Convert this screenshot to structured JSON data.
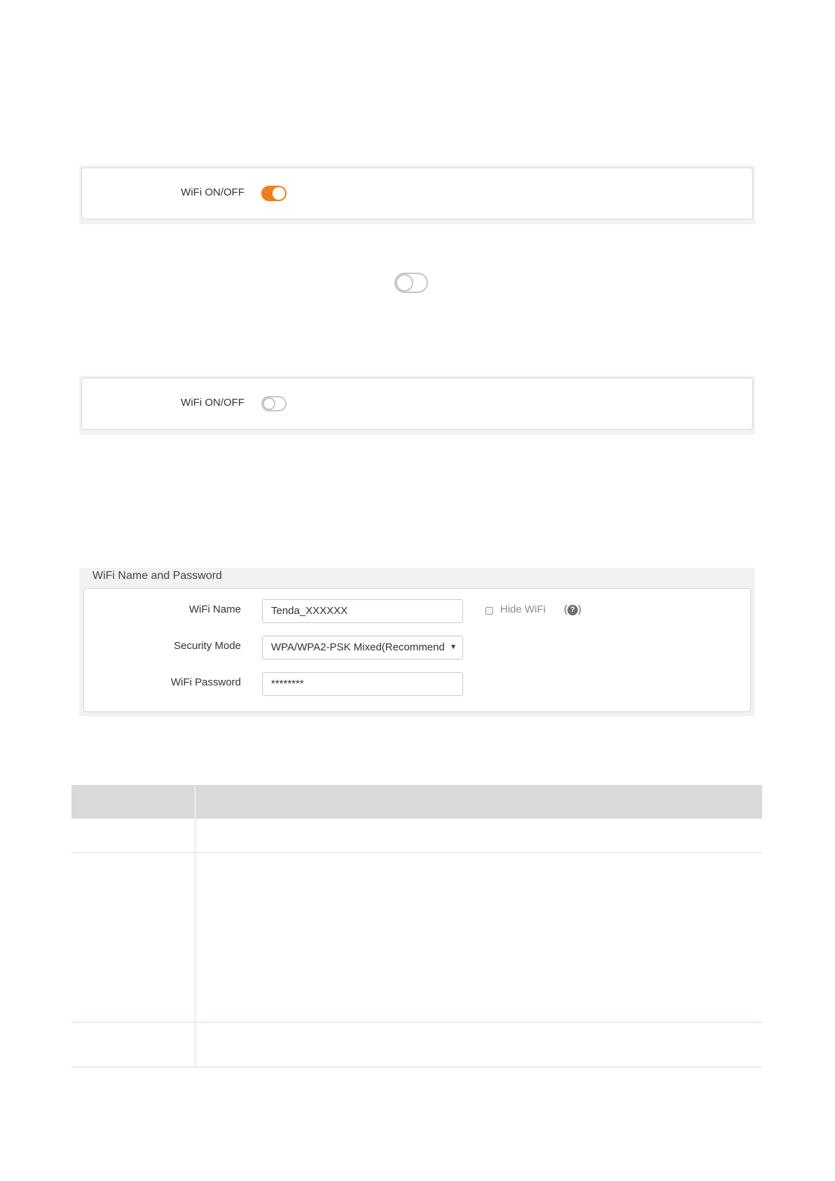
{
  "wifi_on_panel": {
    "label": "WiFi ON/OFF",
    "state": "on"
  },
  "wifi_off_panel": {
    "label": "WiFi ON/OFF",
    "state": "off"
  },
  "wifi_settings": {
    "section_title": "WiFi Name and Password",
    "wifi_name_label": "WiFi Name",
    "wifi_name_value": "Tenda_XXXXXX",
    "hide_wifi_label": "Hide WiFi",
    "hide_wifi_checked": false,
    "help_open": "(",
    "help_glyph": "?",
    "security_mode_label": "Security Mode",
    "security_mode_value": "WPA/WPA2-PSK Mixed(Recommend",
    "wifi_password_label": "WiFi Password",
    "wifi_password_value": "********"
  },
  "colors": {
    "accent": "#f07f1b",
    "toggle_off": "#c6c6c6",
    "table_header": "#d9d9d9"
  }
}
